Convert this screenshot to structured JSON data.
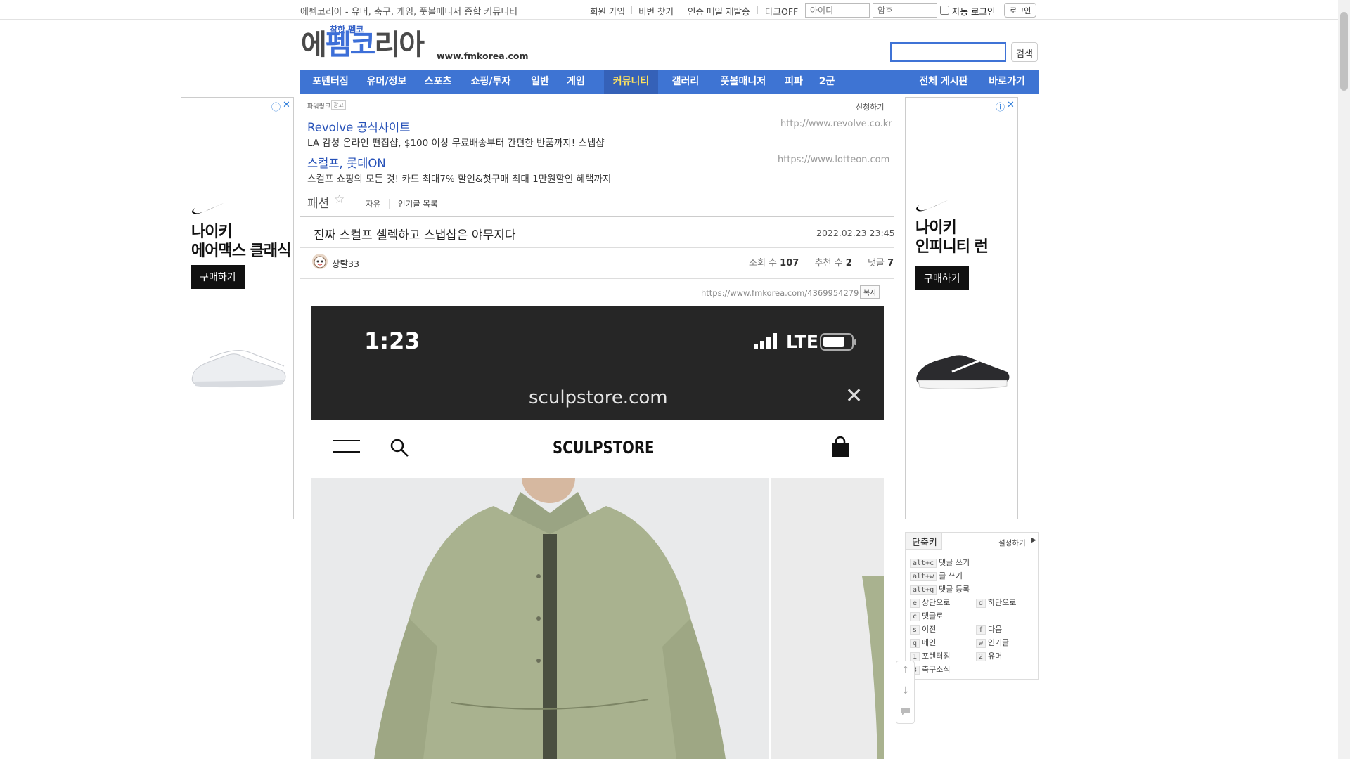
{
  "topbar": {
    "tagline": "에펨코리아 - 유머, 축구, 게임, 풋볼매니저 종합 커뮤니티",
    "links": [
      "회원 가입",
      "비번 찾기",
      "인증 메일 재발송",
      "다크OFF"
    ],
    "id_placeholder": "아이디",
    "pw_placeholder": "암호",
    "auto_login": "자동 로그인",
    "login_button": "로그인"
  },
  "logo": {
    "small": "착한 펨코",
    "main_a": "에",
    "main_b": "펨코",
    "main_c": "리아",
    "url": "www.fmkorea.com"
  },
  "search": {
    "button": "검색"
  },
  "nav": {
    "items": [
      "포텐터짐",
      "유머/정보",
      "스포츠",
      "쇼핑/투자",
      "일반",
      "게임",
      "커뮤니티",
      "갤러리",
      "풋볼매니저",
      "피파",
      "2군"
    ],
    "active_index": 6,
    "right": [
      "전체 게시판",
      "바로가기"
    ]
  },
  "left_ad": {
    "brand_icon": "nike-swoosh-icon",
    "line1": "나이키",
    "line2": "에어맥스 클래식",
    "button": "구매하기"
  },
  "right_ad": {
    "brand_icon": "nike-swoosh-icon",
    "line1": "나이키",
    "line2": "인피니티 런",
    "button": "구매하기"
  },
  "powerlink": {
    "label": "파워링크",
    "badge": "광고",
    "apply": "신청하기",
    "ads": [
      {
        "title": "Revolve 공식사이트",
        "desc": "LA 감성 온라인 편집샵, $100 이상 무료배송부터 간편한 반품까지! 스냅샵",
        "url": "http://www.revolve.co.kr"
      },
      {
        "title": "스컬프, 롯데ON",
        "desc": "스컬프 쇼핑의 모든 것! 카드 최대7% 할인&첫구매 최대 1만원할인 혜택까지",
        "url": "https://www.lotteon.com"
      }
    ]
  },
  "board": {
    "name": "패션",
    "tabs": [
      "자유",
      "인기글 목록"
    ]
  },
  "post": {
    "title": "진짜 스컬프 셀렉하고 스냅샵은 야무지다",
    "date": "2022.02.23 23:45",
    "author": "상탈33",
    "views_label": "조회 수",
    "views": "107",
    "likes_label": "추천 수",
    "likes": "2",
    "comments_label": "댓글",
    "comments": "7",
    "url": "https://www.fmkorea.com/4369954279",
    "copy_button": "복사"
  },
  "phone": {
    "time": "1:23",
    "network": "LTE",
    "address": "sculpstore.com",
    "store_logo": "SCULPSTORE"
  },
  "shortcuts": {
    "title": "단축키",
    "settings": "설정하기",
    "rows": [
      {
        "key": "alt+c",
        "label": "댓글 쓰기"
      },
      {
        "key": "alt+w",
        "label": "글 쓰기"
      },
      {
        "key": "alt+q",
        "label": "댓글 등록"
      },
      {
        "key": "e",
        "label": "상단으로"
      },
      {
        "key": "d",
        "label": "하단으로"
      },
      {
        "key": "c",
        "label": "댓글로"
      },
      {
        "key": "s",
        "label": "이전"
      },
      {
        "key": "f",
        "label": "다음"
      },
      {
        "key": "q",
        "label": "메인"
      },
      {
        "key": "w",
        "label": "인기글"
      },
      {
        "key": "1",
        "label": "포텐터짐"
      },
      {
        "key": "2",
        "label": "유머"
      },
      {
        "key": "3",
        "label": "축구소식"
      }
    ]
  }
}
